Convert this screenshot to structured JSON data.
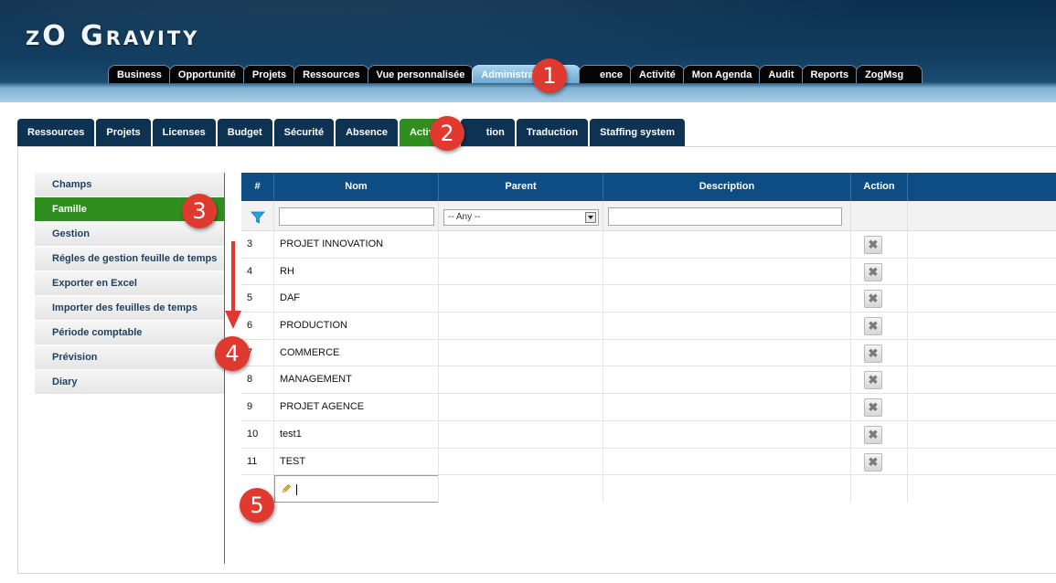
{
  "app": {
    "logo": "zO Gravity"
  },
  "top_nav": [
    {
      "label": "Business",
      "active": false
    },
    {
      "label": "Opportunité",
      "active": false
    },
    {
      "label": "Projets",
      "active": false
    },
    {
      "label": "Ressources",
      "active": false
    },
    {
      "label": "Vue personnalisée",
      "active": false
    },
    {
      "label": "Administration",
      "active": true
    },
    {
      "label": "ence",
      "active": false
    },
    {
      "label": "Activité",
      "active": false
    },
    {
      "label": "Mon Agenda",
      "active": false
    },
    {
      "label": "Audit",
      "active": false
    },
    {
      "label": "Reports",
      "active": false
    },
    {
      "label": "ZogMsg",
      "active": false
    }
  ],
  "sub_nav": [
    {
      "label": "Ressources",
      "active": false
    },
    {
      "label": "Projets",
      "active": false
    },
    {
      "label": "Licenses",
      "active": false
    },
    {
      "label": "Budget",
      "active": false
    },
    {
      "label": "Sécurité",
      "active": false
    },
    {
      "label": "Absence",
      "active": false
    },
    {
      "label": "Activité",
      "active": true
    },
    {
      "label": "tion",
      "active": false
    },
    {
      "label": "Traduction",
      "active": false
    },
    {
      "label": "Staffing system",
      "active": false
    }
  ],
  "side_menu": [
    {
      "label": "Champs",
      "active": false
    },
    {
      "label": "Famille",
      "active": true
    },
    {
      "label": "Gestion",
      "active": false
    },
    {
      "label": "Régles de gestion feuille de temps",
      "active": false
    },
    {
      "label": "Exporter en Excel",
      "active": false
    },
    {
      "label": "Importer des feuilles de temps",
      "active": false
    },
    {
      "label": "Période comptable",
      "active": false
    },
    {
      "label": "Prévision",
      "active": false
    },
    {
      "label": "Diary",
      "active": false
    }
  ],
  "grid": {
    "columns": {
      "num": "#",
      "nom": "Nom",
      "parent": "Parent",
      "description": "Description",
      "action": "Action"
    },
    "filter": {
      "nom_value": "",
      "parent_value": "-- Any --",
      "description_value": ""
    },
    "rows": [
      {
        "id": "3",
        "nom": "PROJET INNOVATION",
        "parent": "",
        "description": ""
      },
      {
        "id": "4",
        "nom": "RH",
        "parent": "",
        "description": ""
      },
      {
        "id": "5",
        "nom": "DAF",
        "parent": "",
        "description": ""
      },
      {
        "id": "6",
        "nom": "PRODUCTION",
        "parent": "",
        "description": ""
      },
      {
        "id": "7",
        "nom": "COMMERCE",
        "parent": "",
        "description": ""
      },
      {
        "id": "8",
        "nom": "MANAGEMENT",
        "parent": "",
        "description": ""
      },
      {
        "id": "9",
        "nom": "PROJET AGENCE",
        "parent": "",
        "description": ""
      },
      {
        "id": "10",
        "nom": "test1",
        "parent": "",
        "description": ""
      },
      {
        "id": "11",
        "nom": "TEST",
        "parent": "",
        "description": ""
      }
    ],
    "delete_icon": "✖",
    "new_row_value": ""
  },
  "callouts": [
    "1",
    "2",
    "3",
    "4",
    "5"
  ],
  "colors": {
    "header_dark": "#0b2f4d",
    "tab_dark": "#0e3252",
    "active_green": "#2f8f1e",
    "grid_head": "#0e4c84",
    "callout_red": "#e0392f"
  }
}
